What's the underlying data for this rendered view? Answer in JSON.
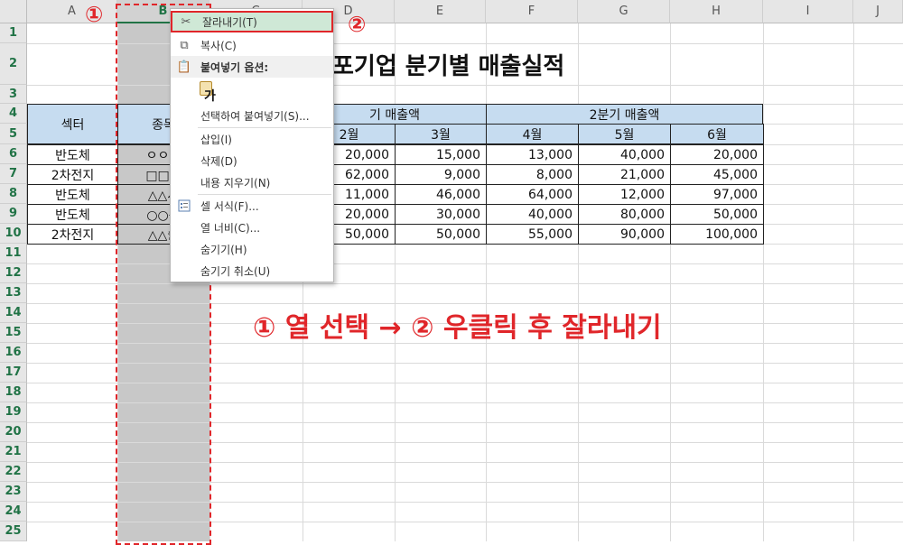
{
  "sheet": {
    "columns": [
      "A",
      "B",
      "C",
      "D",
      "E",
      "F",
      "G",
      "H",
      "I",
      "J"
    ],
    "rows": [
      "1",
      "2",
      "3",
      "4",
      "5",
      "6",
      "7",
      "8",
      "9",
      "10",
      "11",
      "12",
      "13",
      "14",
      "15",
      "16",
      "17",
      "18",
      "19",
      "20",
      "21",
      "22",
      "23",
      "24",
      "25"
    ],
    "selected_column": "B"
  },
  "title": "포기업 분기별 매출실적",
  "table": {
    "col_a_header": "섹터",
    "col_b_header": "종목",
    "q1_header": "기 매출액",
    "q2_header": "2분기 매출액",
    "months": [
      "2월",
      "3월",
      "4월",
      "5월",
      "6월"
    ],
    "rows": [
      {
        "sector": "반도체",
        "name": "ㅇㅇ전",
        "values": [
          "20,000",
          "15,000",
          "13,000",
          "40,000",
          "20,000"
        ]
      },
      {
        "sector": "2차전지",
        "name": "□□퓨",
        "values": [
          "62,000",
          "9,000",
          "8,000",
          "21,000",
          "45,000"
        ]
      },
      {
        "sector": "반도체",
        "name": "△△시",
        "values": [
          "11,000",
          "46,000",
          "64,000",
          "12,000",
          "97,000"
        ]
      },
      {
        "sector": "반도체",
        "name": "○○콘",
        "values": [
          "20,000",
          "30,000",
          "40,000",
          "80,000",
          "50,000"
        ]
      },
      {
        "sector": "2차전지",
        "name": "△△솔",
        "values": [
          "50,000",
          "50,000",
          "55,000",
          "90,000",
          "100,000"
        ]
      }
    ]
  },
  "context_menu": {
    "cut": "잘라내기(T)",
    "copy": "복사(C)",
    "paste_options": "붙여넣기 옵션:",
    "paste_glyph": "가",
    "paste_special": "선택하여 붙여넣기(S)...",
    "insert": "삽입(I)",
    "delete": "삭제(D)",
    "clear_contents": "내용 지우기(N)",
    "format_cells": "셀 서식(F)...",
    "column_width": "열 너비(C)...",
    "hide": "숨기기(H)",
    "unhide": "숨기기 취소(U)"
  },
  "annotations": {
    "marker_1": "①",
    "marker_2": "②",
    "caption": "① 열 선택 → ② 우클릭 후 잘라내기"
  },
  "colors": {
    "accent_red": "#e0262a",
    "excel_green": "#217346",
    "header_blue": "#c6dcf0",
    "selection_gray": "#c8c8c8"
  }
}
